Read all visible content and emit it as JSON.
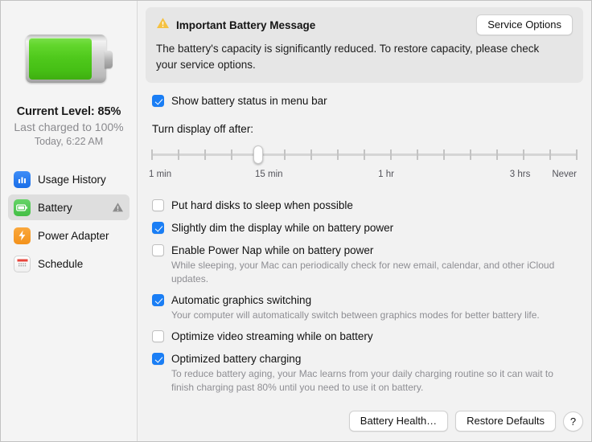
{
  "sidebar": {
    "battery": {
      "fill_percent": 85,
      "current_level": "Current Level: 85%",
      "last_charged": "Last charged to 100%",
      "last_charged_time": "Today, 6:22 AM"
    },
    "items": [
      {
        "label": "Usage History",
        "icon": "bar-chart-icon",
        "selected": false,
        "warning": false
      },
      {
        "label": "Battery",
        "icon": "battery-icon",
        "selected": true,
        "warning": true
      },
      {
        "label": "Power Adapter",
        "icon": "power-bolt-icon",
        "selected": false,
        "warning": false
      },
      {
        "label": "Schedule",
        "icon": "calendar-icon",
        "selected": false,
        "warning": false
      }
    ]
  },
  "banner": {
    "icon": "warning-triangle-icon",
    "title": "Important Battery Message",
    "body": "The battery's capacity is significantly reduced. To restore capacity, please check your service options.",
    "action_label": "Service Options"
  },
  "menubar_option": {
    "label": "Show battery status in menu bar",
    "checked": true
  },
  "slider": {
    "caption": "Turn display off after:",
    "value_label": "15 min",
    "thumb_percent": 25,
    "tick_count": 17,
    "labels": [
      {
        "text": "1 min",
        "percent": 0
      },
      {
        "text": "15 min",
        "percent": 25
      },
      {
        "text": "1 hr",
        "percent": 54
      },
      {
        "text": "3 hrs",
        "percent": 85
      },
      {
        "text": "Never",
        "percent": 100
      }
    ]
  },
  "options": [
    {
      "label": "Put hard disks to sleep when possible",
      "checked": false,
      "help": ""
    },
    {
      "label": "Slightly dim the display while on battery power",
      "checked": true,
      "help": ""
    },
    {
      "label": "Enable Power Nap while on battery power",
      "checked": false,
      "help": "While sleeping, your Mac can periodically check for new email, calendar, and other iCloud updates."
    },
    {
      "label": "Automatic graphics switching",
      "checked": true,
      "help": "Your computer will automatically switch between graphics modes for better battery life."
    },
    {
      "label": "Optimize video streaming while on battery",
      "checked": false,
      "help": ""
    },
    {
      "label": "Optimized battery charging",
      "checked": true,
      "help": "To reduce battery aging, your Mac learns from your daily charging routine so it can wait to finish charging past 80% until you need to use it on battery."
    }
  ],
  "footer": {
    "battery_health_label": "Battery Health…",
    "restore_defaults_label": "Restore Defaults",
    "help_label": "?"
  },
  "colors": {
    "accent_blue": "#1a7ef5",
    "warning_yellow": "#f5c141",
    "battery_green": "#4fc91c",
    "icon_blue": "#1a6ee8",
    "icon_orange": "#f3921b",
    "window_bg": "#f2f2f2",
    "banner_bg": "#e6e6e6"
  }
}
